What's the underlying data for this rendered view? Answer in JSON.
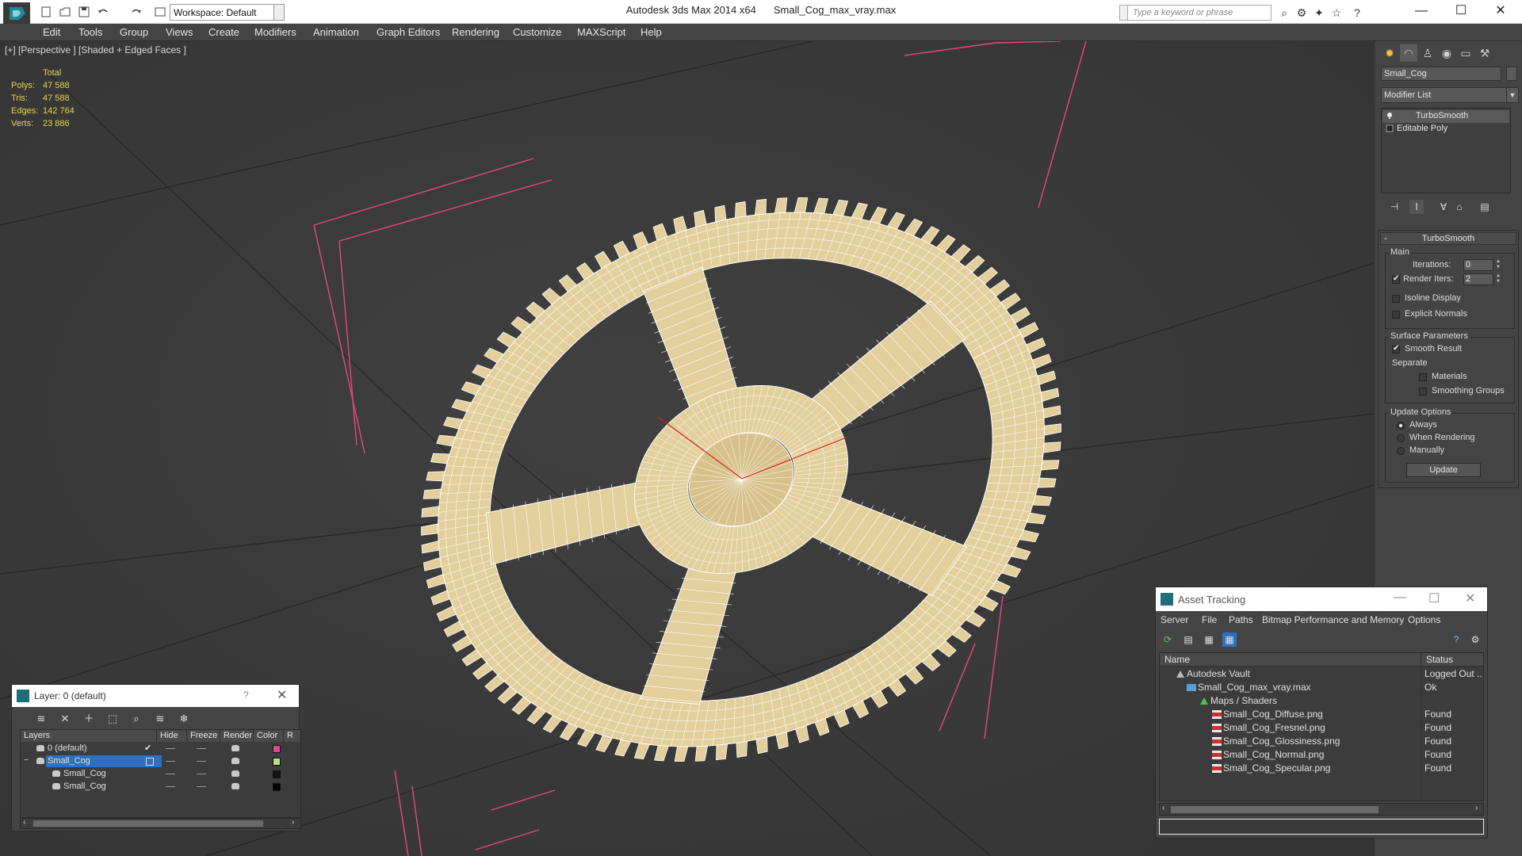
{
  "window": {
    "app": "Autodesk 3ds Max  2014 x64",
    "file": "Small_Cog_max_vray.max",
    "workspace": "Workspace: Default",
    "search_placeholder": "Type a keyword or phrase"
  },
  "menu": [
    "Edit",
    "Tools",
    "Group",
    "Views",
    "Create",
    "Modifiers",
    "Animation",
    "Graph Editors",
    "Rendering",
    "Customize",
    "MAXScript",
    "Help"
  ],
  "viewport": {
    "label": "[+] [Perspective ] [Shaded + Edged Faces ]",
    "stats": {
      "header": "Total",
      "polys_label": "Polys:",
      "polys": "47 588",
      "tris_label": "Tris:",
      "tris": "47 588",
      "edges_label": "Edges:",
      "edges": "142 764",
      "verts_label": "Verts:",
      "verts": "23 886"
    },
    "gear": {
      "teeth": 96
    }
  },
  "command_panel": {
    "object_name": "Small_Cog",
    "modifier_list": "Modifier List",
    "stack": [
      "TurboSmooth",
      "Editable Poly"
    ],
    "rollout": {
      "title": "TurboSmooth",
      "main_group": "Main",
      "iterations_label": "Iterations:",
      "iterations": "0",
      "render_iters_label": "Render Iters:",
      "render_iters": "2",
      "isoline": "Isoline Display",
      "explicit_normals": "Explicit Normals",
      "surface_group": "Surface Parameters",
      "smooth_result": "Smooth Result",
      "separate": "Separate",
      "materials": "Materials",
      "smoothing_groups": "Smoothing Groups",
      "update_group": "Update Options",
      "always": "Always",
      "when_rendering": "When Rendering",
      "manually": "Manually",
      "update_button": "Update"
    }
  },
  "layer_dialog": {
    "title": "Layer: 0 (default)",
    "help": "?",
    "columns": [
      "Layers",
      "Hide",
      "Freeze",
      "Render",
      "Color",
      "R"
    ],
    "rows": [
      {
        "name": "0 (default)",
        "color": "#e0458c"
      },
      {
        "name": "Small_Cog",
        "color": "#b8e08a"
      },
      {
        "name": "Small_Cog",
        "color": "#141414"
      },
      {
        "name": "Small_Cog",
        "color": "#000000"
      }
    ]
  },
  "asset_tracking": {
    "title": "Asset Tracking",
    "menu": [
      "Server",
      "File",
      "Paths",
      "Bitmap Performance and Memory",
      "Options"
    ],
    "columns": [
      "Name",
      "Status"
    ],
    "rows": [
      {
        "name": "Autodesk Vault",
        "status": "Logged Out ..."
      },
      {
        "name": "Small_Cog_max_vray.max",
        "status": "Ok"
      },
      {
        "name": "Maps / Shaders",
        "status": ""
      },
      {
        "name": "Small_Cog_Diffuse.png",
        "status": "Found"
      },
      {
        "name": "Small_Cog_Fresnel.png",
        "status": "Found"
      },
      {
        "name": "Small_Cog_Glossiness.png",
        "status": "Found"
      },
      {
        "name": "Small_Cog_Normal.png",
        "status": "Found"
      },
      {
        "name": "Small_Cog_Specular.png",
        "status": "Found"
      }
    ]
  },
  "colors": {
    "ui_dark": "#444444",
    "viewport_bg": "#3b3b3b",
    "stats_text": "#e6d54a",
    "gear_fill": "#e3cf9c",
    "wire": "#ffffff",
    "bbox": "#e64a7a",
    "selection": "#2d6fc0"
  }
}
